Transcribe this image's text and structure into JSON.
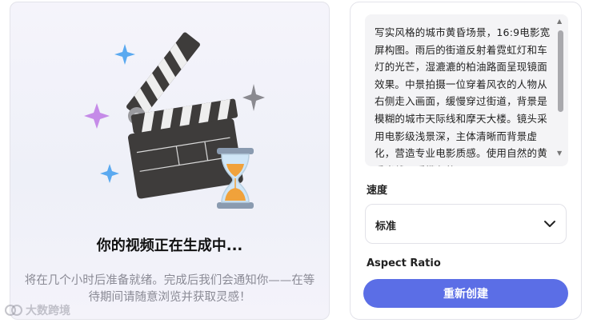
{
  "status": {
    "title": "你的视频正在生成中...",
    "description_line1": "将在几个小时后准备就绪。完成后我们会通知你——在等",
    "description_line2": "待期间请随意浏览并获取灵感！"
  },
  "watermark": {
    "text": "大数跨境"
  },
  "prompt": {
    "text": "写实风格的城市黄昏场景，16:9电影宽屏构图。雨后的街道反射着霓虹灯和车灯的光芒，湿漉漉的柏油路面呈现镜面效果。中景拍摄一位穿着风衣的人物从右侧走入画面，缓慢穿过街道，背景是模糊的城市天际线和摩天大楼。镜头采用电影级浅景深，主体清晰而背景虚化，营造专业电影质感。使用自然的黄昏光线，暖橙色的"
  },
  "speed": {
    "label": "速度",
    "value": "标准"
  },
  "aspect_ratio": {
    "label": "Aspect Ratio"
  },
  "actions": {
    "recreate_label": "重新创建"
  },
  "icons": {
    "illustration": "clapperboard-icon",
    "timer": "hourglass-icon",
    "sparkle": "sparkle-icon",
    "dropdown": "chevron-down-icon"
  },
  "colors": {
    "accent": "#5b6ee6",
    "sparkle_blue": "#5aa9f0",
    "sparkle_purple": "#c58be8"
  }
}
